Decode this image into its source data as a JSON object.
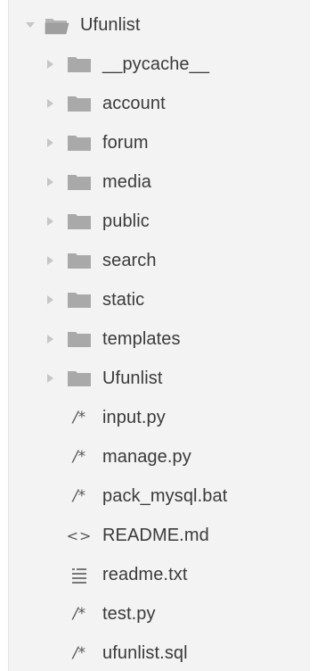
{
  "root": {
    "label": "Ufunlist",
    "expanded": true
  },
  "folders": [
    {
      "label": "__pycache__"
    },
    {
      "label": "account"
    },
    {
      "label": "forum"
    },
    {
      "label": "media"
    },
    {
      "label": "public"
    },
    {
      "label": "search"
    },
    {
      "label": "static"
    },
    {
      "label": "templates"
    },
    {
      "label": "Ufunlist"
    }
  ],
  "files": [
    {
      "label": "input.py",
      "icon": "python-comment-icon",
      "glyph": "/*"
    },
    {
      "label": "manage.py",
      "icon": "python-comment-icon",
      "glyph": "/*"
    },
    {
      "label": "pack_mysql.bat",
      "icon": "python-comment-icon",
      "glyph": "/*"
    },
    {
      "label": "README.md",
      "icon": "markup-icon",
      "glyph": "<>"
    },
    {
      "label": "readme.txt",
      "icon": "text-lines-icon",
      "glyph": ""
    },
    {
      "label": "test.py",
      "icon": "python-comment-icon",
      "glyph": "/*"
    },
    {
      "label": "ufunlist.sql",
      "icon": "python-comment-icon",
      "glyph": "/*"
    }
  ],
  "colors": {
    "background": "#f3f3f3",
    "text": "#3a3a3a",
    "folder": "#a9a9a9",
    "caret": "#c6c6c6"
  }
}
